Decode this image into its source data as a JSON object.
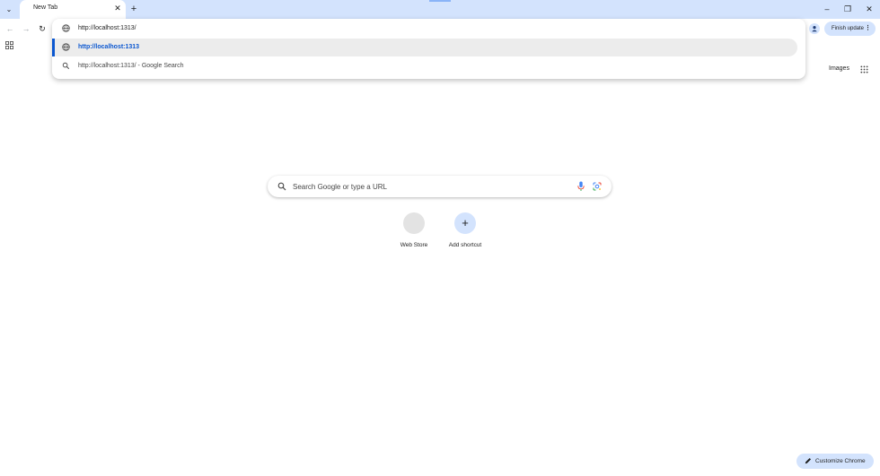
{
  "tabstrip": {
    "tab_title": "New Tab",
    "close_glyph": "✕",
    "new_tab_glyph": "+",
    "search_tabs_glyph": "⌄"
  },
  "window": {
    "minimize": "–",
    "maximize": "❐",
    "close": "✕"
  },
  "toolbar": {
    "back": "←",
    "forward": "→",
    "reload": "↻",
    "finish_update_label": "Finish update",
    "menu_glyph": "⋮"
  },
  "omnibox": {
    "input_value": "http://localhost:1313/",
    "suggestions": [
      {
        "text": "http://localhost:1313",
        "icon": "globe-icon",
        "selected": true
      },
      {
        "text": "http://localhost:1313/ - Google Search",
        "icon": "search-icon",
        "selected": false
      }
    ]
  },
  "ntp": {
    "images_link": "Images",
    "search_placeholder": "Search Google or type a URL",
    "shortcuts": [
      {
        "label": "Web Store"
      },
      {
        "label": "Add shortcut",
        "glyph": "+"
      }
    ],
    "customize_label": "Customize Chrome"
  },
  "colors": {
    "tabstrip_bg": "#d3e3fd",
    "accent": "#0b57d0",
    "selected_row": "#ececec"
  }
}
